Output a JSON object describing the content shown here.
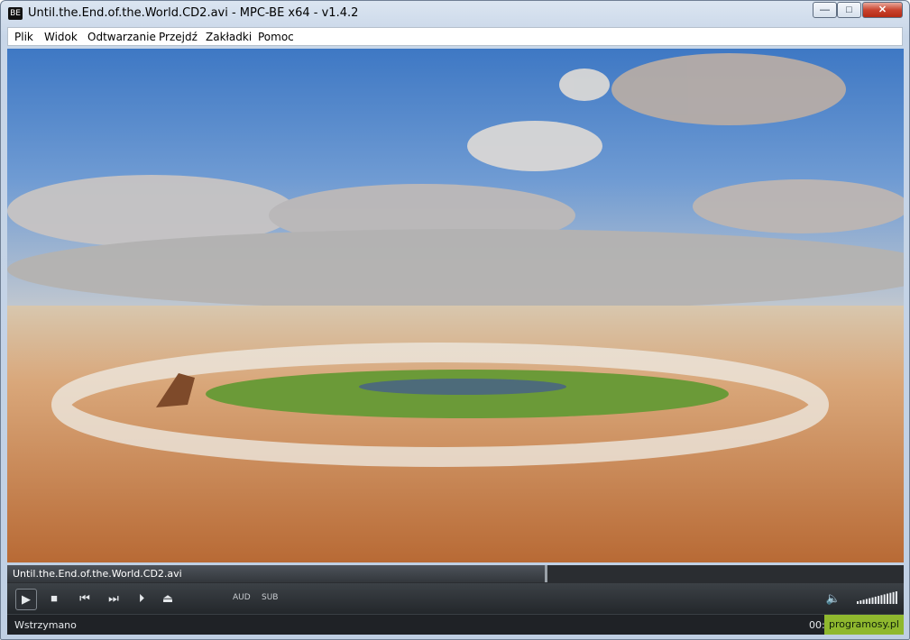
{
  "window": {
    "title": "Until.the.End.of.the.World.CD2.avi - MPC-BE x64 - v1.4.2",
    "minimize_label": "—",
    "maximize_label": "□",
    "close_label": "✕"
  },
  "menu": {
    "items": [
      {
        "label": "Plik"
      },
      {
        "label": "Widok"
      },
      {
        "label": "Odtwarzanie"
      },
      {
        "label": "Przejdź"
      },
      {
        "label": "Zakładki"
      },
      {
        "label": "Pomoc"
      }
    ]
  },
  "seekbar": {
    "label": "Until.the.End.of.the.World.CD2.avi",
    "progress": 0.6
  },
  "controls": {
    "play_icon": "play-icon",
    "audio_label": "AUD",
    "subtitle_label": "SUB",
    "volume_level": 1.0
  },
  "status": {
    "state": "Wstrzymano",
    "time": "00:5"
  },
  "watermark": {
    "text": "programosy.pl"
  },
  "colors": {
    "accent": "#8fb82e",
    "close": "#c9442f"
  }
}
